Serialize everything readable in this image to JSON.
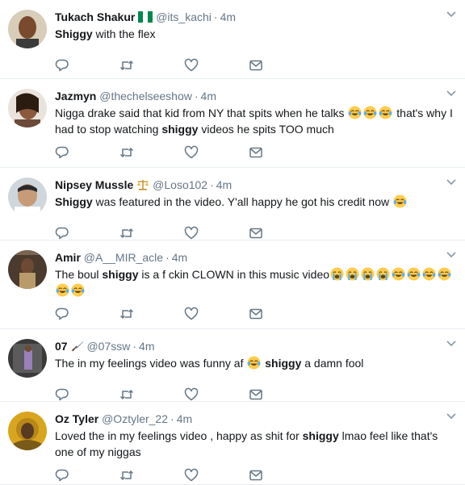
{
  "tweets": [
    {
      "name": "Tukach Shakur",
      "handle": "@its_kachi",
      "sep": "·",
      "time": "4m",
      "badge": "flag-nigeria",
      "parts": [
        {
          "b": "Shiggy"
        },
        {
          "t": " with the flex"
        }
      ]
    },
    {
      "name": "Jazmyn",
      "handle": "@thechelseeshow",
      "sep": "·",
      "time": "4m",
      "badge": "",
      "parts": [
        {
          "t": "Nigga drake said that kid from NY that spits when he talks "
        },
        {
          "e": "tears-of-joy"
        },
        {
          "e": "tears-of-joy"
        },
        {
          "e": "tears-of-joy"
        },
        {
          "t": " that's why I had to stop watching "
        },
        {
          "b": "shiggy"
        },
        {
          "t": " videos he spits TOO much"
        }
      ]
    },
    {
      "name": "Nipsey Mussle",
      "handle": "@Loso102",
      "sep": "·",
      "time": "4m",
      "badge": "scales-icon",
      "parts": [
        {
          "b": "Shiggy"
        },
        {
          "t": " was featured in the video. Y'all happy he got his credit now "
        },
        {
          "e": "tears-of-joy"
        }
      ]
    },
    {
      "name": "Amir",
      "handle": "@A__MIR_acle",
      "sep": "·",
      "time": "4m",
      "badge": "",
      "parts": [
        {
          "t": "The boul "
        },
        {
          "b": "shiggy"
        },
        {
          "t": " is a f   ckin CLOWN in this music video"
        },
        {
          "e": "loudly-crying"
        },
        {
          "e": "loudly-crying"
        },
        {
          "e": "loudly-crying"
        },
        {
          "e": "loudly-crying"
        },
        {
          "e": "tears-of-joy"
        },
        {
          "e": "tears-of-joy"
        },
        {
          "e": "tears-of-joy"
        },
        {
          "e": "tears-of-joy"
        },
        {
          "e": "tears-of-joy"
        },
        {
          "e": "tears-of-joy"
        }
      ]
    },
    {
      "name": "07",
      "handle": "@07ssw",
      "sep": "·",
      "time": "4m",
      "badge": "dagger-icon",
      "parts": [
        {
          "t": "The in my feelings video was funny af "
        },
        {
          "e": "tears-of-joy"
        },
        {
          "t": " "
        },
        {
          "b": "shiggy"
        },
        {
          "t": " a damn fool"
        }
      ]
    },
    {
      "name": "Oz Tyler",
      "handle": "@Oztyler_22",
      "sep": "·",
      "time": "4m",
      "badge": "",
      "parts": [
        {
          "t": "Loved the in my feelings video , happy as shit for "
        },
        {
          "b": "shiggy"
        },
        {
          "t": " lmao feel like that's one of my niggas"
        }
      ]
    }
  ],
  "actions": [
    "reply-icon",
    "retweet-icon",
    "like-icon",
    "message-icon"
  ],
  "colors": {
    "name": "#14171a",
    "muted": "#657786",
    "border": "#e6ecf0",
    "icon": "#657786"
  }
}
